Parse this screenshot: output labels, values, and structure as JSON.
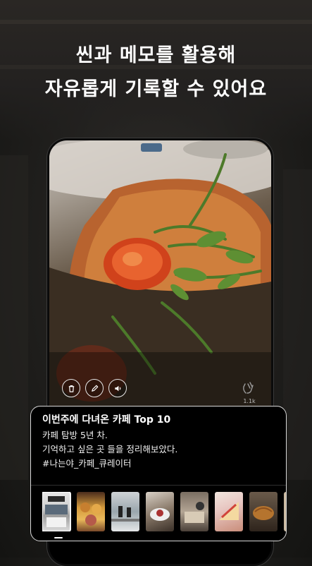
{
  "headline": {
    "line1": "씬과 메모를 활용해",
    "line2": "자유롭게 기록할 수 있어요"
  },
  "post": {
    "actions": [
      {
        "name": "delete",
        "icon": "trash-icon"
      },
      {
        "name": "edit",
        "icon": "pencil-icon"
      },
      {
        "name": "sound",
        "icon": "speaker-icon"
      }
    ],
    "clap": {
      "icon": "clap-hands-icon",
      "count": "1.1k"
    }
  },
  "card": {
    "title": "이번주에 다녀온 카페 Top 10",
    "lines": [
      "카페 탐방 5년 차.",
      "기억하고 싶은 곳 들을 정리해보았다.",
      "#나는야_카페_큐레이터"
    ],
    "thumbnails": [
      {
        "label": "cafe storefront",
        "selected": true
      },
      {
        "label": "pastries",
        "selected": false
      },
      {
        "label": "cafe interior",
        "selected": false
      },
      {
        "label": "dessert plate",
        "selected": false
      },
      {
        "label": "table scene",
        "selected": false
      },
      {
        "label": "cake",
        "selected": false
      },
      {
        "label": "croissant",
        "selected": false
      },
      {
        "label": "partial",
        "selected": false
      }
    ]
  },
  "colors": {
    "background": "#1f1e1c",
    "card_border": "#d8d8d8",
    "text": "#ffffff"
  }
}
